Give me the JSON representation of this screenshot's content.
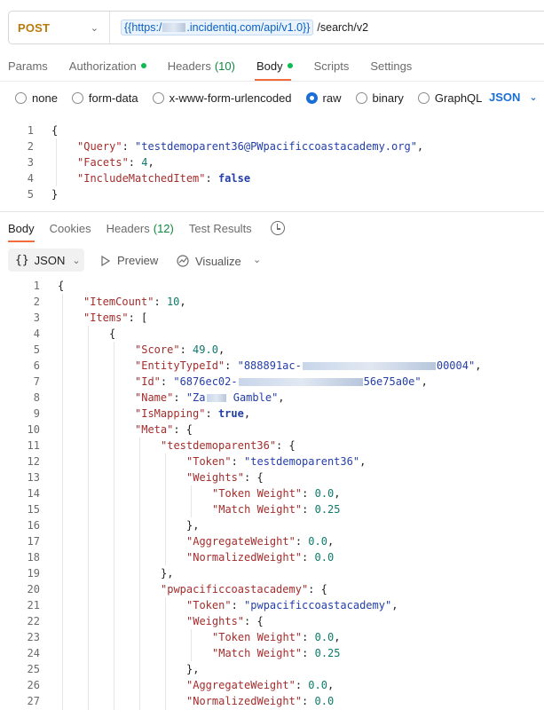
{
  "request": {
    "method": "POST",
    "url_var_prefix": "{{https:/",
    "url_var_suffix": ".incidentiq.com/api/v1.0}}",
    "url_path": "/search/v2"
  },
  "request_tabs": [
    {
      "label": "Params"
    },
    {
      "label": "Authorization",
      "dot": true
    },
    {
      "label": "Headers",
      "count": "(10)"
    },
    {
      "label": "Body",
      "dot": true,
      "active": true
    },
    {
      "label": "Scripts"
    },
    {
      "label": "Settings"
    }
  ],
  "body_types": [
    "none",
    "form-data",
    "x-www-form-urlencoded",
    "raw",
    "binary",
    "GraphQL"
  ],
  "body_type_selected": "raw",
  "body_language": "JSON",
  "request_body": [
    "{",
    "\"Query\": \"testdemoparent36@PWpacificcoastacademy.org\",",
    "\"Facets\": 4,",
    "\"IncludeMatchedItem\": false",
    "}"
  ],
  "response_tabs": [
    {
      "label": "Body",
      "active": true
    },
    {
      "label": "Cookies"
    },
    {
      "label": "Headers",
      "count": "(12)"
    },
    {
      "label": "Test Results"
    }
  ],
  "response_toolbar": {
    "format_braces": "{}",
    "format_label": "JSON",
    "preview_label": "Preview",
    "visualize_label": "Visualize"
  },
  "response_body": {
    "item_count_key": "\"ItemCount\"",
    "item_count_val": "10",
    "items_key": "\"Items\"",
    "score_key": "\"Score\"",
    "score_val": "49.0",
    "entity_key": "\"EntityTypeId\"",
    "entity_val_start": "\"888891ac-",
    "entity_val_end": "00004\"",
    "id_key": "\"Id\"",
    "id_val_start": "\"6876ec02-",
    "id_val_end": "56e75a0e\"",
    "name_key": "\"Name\"",
    "name_val_start": "\"Za",
    "name_val_end": " Gamble\"",
    "ismapping_key": "\"IsMapping\"",
    "ismapping_val": "true",
    "meta_key": "\"Meta\"",
    "meta1_key": "\"testdemoparent36\"",
    "meta1_token": "\"testdemoparent36\"",
    "meta2_key": "\"pwpacificcoastacademy\"",
    "meta2_token": "\"pwpacificcoastacademy\"",
    "token_key": "\"Token\"",
    "weights_key": "\"Weights\"",
    "token_weight_key": "\"Token Weight\"",
    "token_weight_val": "0.0",
    "match_weight_key": "\"Match Weight\"",
    "match_weight_val": "0.25",
    "aggregate_key": "\"AggregateWeight\"",
    "aggregate_val": "0.0",
    "normalized_key": "\"NormalizedWeight\"",
    "normalized_val": "0.0"
  },
  "line_numbers_request": [
    "1",
    "2",
    "3",
    "4",
    "5"
  ],
  "line_numbers_response": [
    "1",
    "2",
    "3",
    "4",
    "5",
    "6",
    "7",
    "8",
    "9",
    "10",
    "11",
    "12",
    "13",
    "14",
    "15",
    "16",
    "17",
    "18",
    "19",
    "20",
    "21",
    "22",
    "23",
    "24",
    "25",
    "26",
    "27"
  ]
}
